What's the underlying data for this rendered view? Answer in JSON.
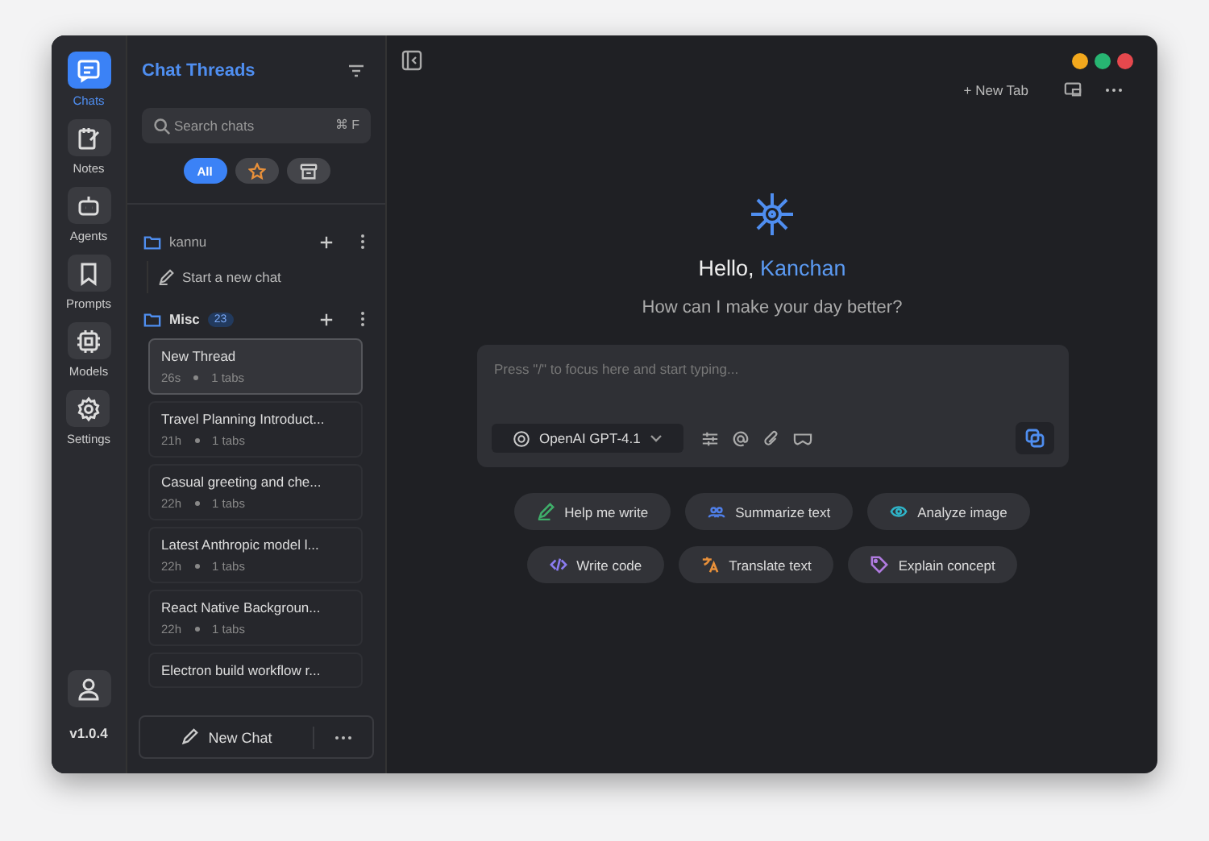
{
  "rail": {
    "items": [
      {
        "label": "Chats",
        "kind": "chats",
        "selected": true
      },
      {
        "label": "Notes",
        "kind": "notes",
        "selected": false
      },
      {
        "label": "Agents",
        "kind": "agents",
        "selected": false
      },
      {
        "label": "Prompts",
        "kind": "prompts",
        "selected": false
      },
      {
        "label": "Models",
        "kind": "models",
        "selected": false
      },
      {
        "label": "Settings",
        "kind": "settings",
        "selected": false
      }
    ],
    "version": "v1.0.4"
  },
  "sidebar": {
    "title": "Chat Threads",
    "search": {
      "placeholder": "Search chats",
      "shortcut": "⌘ F"
    },
    "filters": [
      {
        "kind": "all",
        "label": "All",
        "selected": true
      },
      {
        "kind": "starred",
        "selected": false
      },
      {
        "kind": "archived",
        "selected": false
      }
    ],
    "folders": [
      {
        "name": "kannu",
        "bold": false,
        "empty_action": "Start a new chat"
      },
      {
        "name": "Misc",
        "bold": true,
        "count": "23",
        "threads": [
          {
            "title": "New Thread",
            "age": "26s",
            "tabs": "1 tabs",
            "selected": true
          },
          {
            "title": "Travel Planning Introduct...",
            "age": "21h",
            "tabs": "1 tabs",
            "selected": false
          },
          {
            "title": "Casual greeting and che...",
            "age": "22h",
            "tabs": "1 tabs",
            "selected": false
          },
          {
            "title": "Latest Anthropic model l...",
            "age": "22h",
            "tabs": "1 tabs",
            "selected": false
          },
          {
            "title": "React Native Backgroun...",
            "age": "22h",
            "tabs": "1 tabs",
            "selected": false
          },
          {
            "title": "Electron build workflow r...",
            "selected": false
          }
        ]
      }
    ],
    "new_chat": "New Chat"
  },
  "toolbar": {
    "new_tab": "+ New Tab"
  },
  "welcome": {
    "greeting": "Hello,",
    "name": "Kanchan",
    "subtitle": "How can I make your day better?"
  },
  "composer": {
    "placeholder": "Press \"/\" to focus here and start typing...",
    "model": "OpenAI GPT-4.1"
  },
  "suggestions": [
    [
      {
        "kind": "write",
        "label": "Help me write"
      },
      {
        "kind": "summarize",
        "label": "Summarize text"
      },
      {
        "kind": "analyze",
        "label": "Analyze image"
      }
    ],
    [
      {
        "kind": "code",
        "label": "Write code"
      },
      {
        "kind": "translate",
        "label": "Translate text"
      },
      {
        "kind": "explain",
        "label": "Explain concept"
      }
    ]
  ]
}
